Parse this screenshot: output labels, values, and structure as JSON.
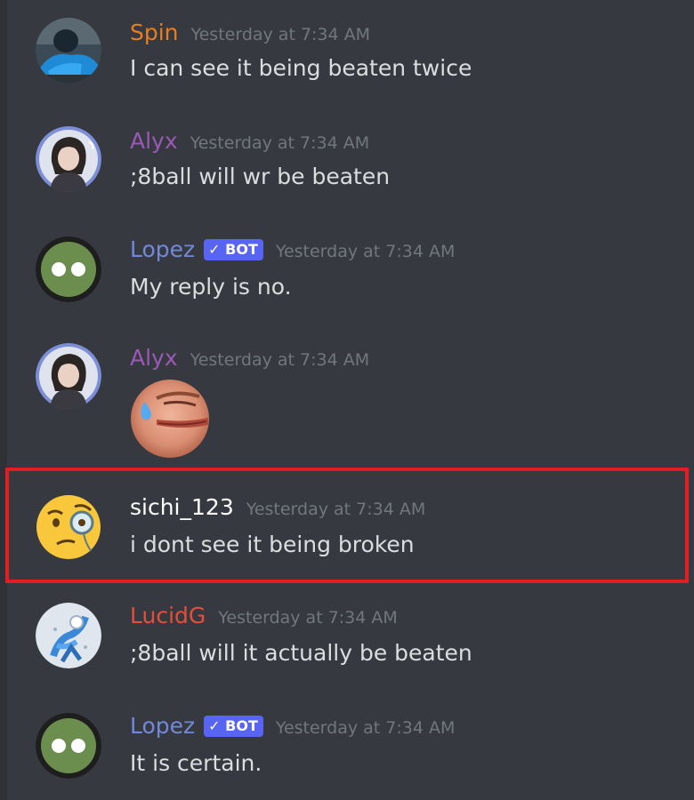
{
  "messages": [
    {
      "username": "Spin",
      "color": "#e67e22",
      "timestamp": "Yesterday at 7:34 AM",
      "text": "I can see it being beaten twice",
      "avatar": "spin-avatar-icon"
    },
    {
      "username": "Alyx",
      "color": "#9b59b6",
      "timestamp": "Yesterday at 7:34 AM",
      "text": ";8ball will wr be beaten",
      "avatar": "alyx-avatar-icon"
    },
    {
      "username": "Lopez",
      "color": "#7289da",
      "bot_label": "✓ BOT",
      "timestamp": "Yesterday at 7:34 AM",
      "text": "My reply is no.",
      "avatar": "lopez-bot-avatar-icon"
    },
    {
      "username": "Alyx",
      "color": "#9b59b6",
      "timestamp": "Yesterday at 7:34 AM",
      "text": "",
      "emoji": "sweating-face-emoji-icon",
      "avatar": "alyx-avatar-icon"
    },
    {
      "username": "sichi_123",
      "color": "#ffffff",
      "timestamp": "Yesterday at 7:34 AM",
      "text": "i dont see it being broken",
      "avatar": "face-with-monocle-icon",
      "highlighted": true
    },
    {
      "username": "LucidG",
      "color": "#e74c3c",
      "timestamp": "Yesterday at 7:34 AM",
      "text": ";8ball will it actually be beaten",
      "avatar": "lucidg-avatar-icon"
    },
    {
      "username": "Lopez",
      "color": "#7289da",
      "bot_label": "✓ BOT",
      "timestamp": "Yesterday at 7:34 AM",
      "text": "It is certain.",
      "avatar": "lopez-bot-avatar-icon"
    }
  ],
  "colors": {
    "background": "#36393f",
    "timestamp": "#72767d",
    "message_text": "#dcddde",
    "bot_tag": "#5865f2",
    "highlight_border": "#e01e24"
  }
}
